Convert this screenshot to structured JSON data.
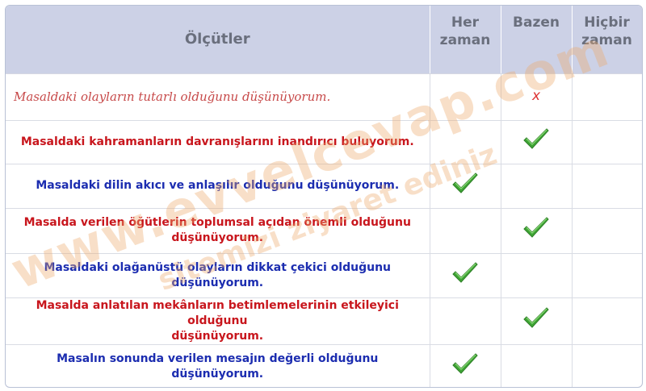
{
  "header": {
    "criteria": "Ölçütler",
    "col_always_line1": "Her",
    "col_always_line2": "zaman",
    "col_sometimes": "Bazen",
    "col_never_line1": "Hiçbir",
    "col_never_line2": "zaman"
  },
  "rows": [
    {
      "text_1": "Masaldaki olayların tutarlı olduğunu düşünüyorum.",
      "text_2": "",
      "mark": "cross",
      "column": "sometimes"
    },
    {
      "text_1": "Masaldaki kahramanların davranışlarını inandırıcı buluyorum.",
      "text_2": "",
      "mark": "check",
      "column": "sometimes"
    },
    {
      "text_1": "Masaldaki dilin akıcı ve anlaşılır olduğunu düşünüyorum.",
      "text_2": "",
      "mark": "check",
      "column": "always"
    },
    {
      "text_1": "Masalda verilen öğütlerin toplumsal açıdan önemli olduğunu",
      "text_2": "düşünüyorum.",
      "mark": "check",
      "column": "sometimes"
    },
    {
      "text_1": "Masaldaki olağanüstü olayların dikkat çekici olduğunu düşünüyorum.",
      "text_2": "",
      "mark": "check",
      "column": "always"
    },
    {
      "text_1": "Masalda anlatılan mekânların betimlemelerinin etkileyici olduğunu",
      "text_2": "düşünüyorum.",
      "mark": "check",
      "column": "sometimes"
    },
    {
      "text_1": "Masalın sonunda verilen mesajın değerli olduğunu düşünüyorum.",
      "text_2": "",
      "mark": "check",
      "column": "always"
    }
  ],
  "marks": {
    "cross_glyph": "x"
  },
  "watermark": {
    "line1": "www.evvelcevap.com",
    "line2": "sitemizi ziyaret ediniz"
  },
  "colors": {
    "header_bg": "#ccd1e6",
    "red_text": "#c8161d",
    "blue_text": "#1c2db0",
    "check_green": "#3fa535"
  }
}
